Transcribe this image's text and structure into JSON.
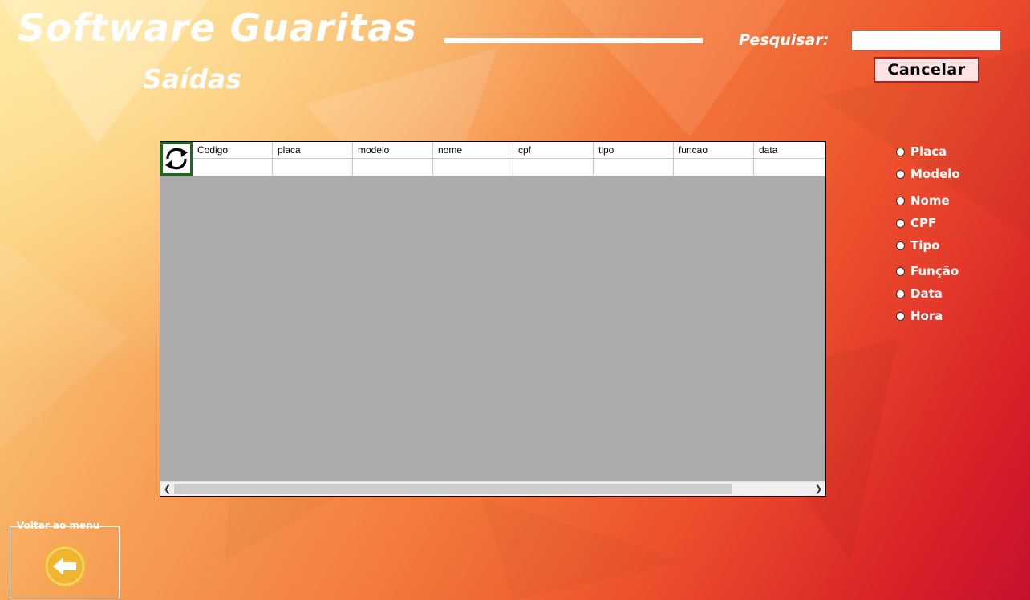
{
  "header": {
    "title": "Software Guaritas",
    "subtitle": "Saídas"
  },
  "search": {
    "label": "Pesquisar:",
    "value": "",
    "cancel_label": "Cancelar"
  },
  "grid": {
    "columns": [
      "Codigo",
      "placa",
      "modelo",
      "nome",
      "cpf",
      "tipo",
      "funcao",
      "data"
    ],
    "rows": [
      [
        "",
        "",
        "",
        "",
        "",
        "",
        "",
        ""
      ]
    ],
    "refresh_icon": "refresh-icon"
  },
  "filters": [
    {
      "label": "Placa",
      "checked": false
    },
    {
      "label": "Modelo",
      "checked": false
    },
    {
      "label": "Nome",
      "checked": false
    },
    {
      "label": "CPF",
      "checked": false
    },
    {
      "label": "Tipo",
      "checked": false
    },
    {
      "label": "Função",
      "checked": false
    },
    {
      "label": "Data",
      "checked": false
    },
    {
      "label": "Hora",
      "checked": false
    }
  ],
  "back": {
    "label": "Voltar ao menu",
    "icon": "arrow-left-icon"
  },
  "colors": {
    "accent_button_bg": "#fde3e3",
    "accent_button_border": "#b02020",
    "grid_selection": "#1a6b1a",
    "grid_empty": "#ababab",
    "back_icon": "#f1b52d"
  }
}
